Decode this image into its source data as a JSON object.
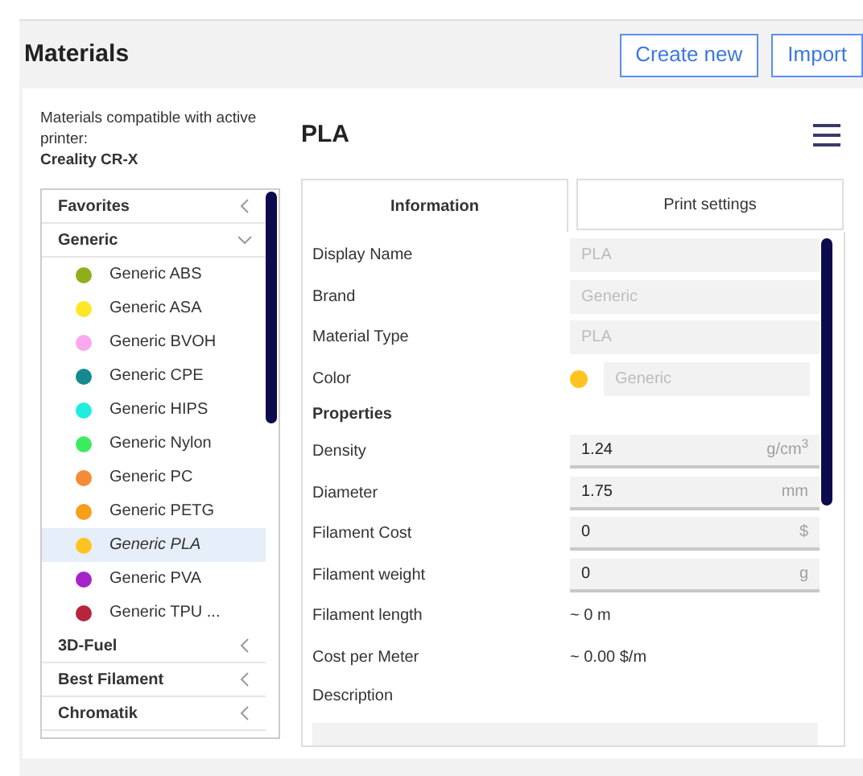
{
  "title": "Materials",
  "buttons": [
    "Create new",
    "Import"
  ],
  "compat": {
    "label": "Materials compatible with active printer:",
    "printer": "Creality CR-X"
  },
  "categories": [
    {
      "name": "Favorites",
      "expanded": false
    },
    {
      "name": "Generic",
      "expanded": true,
      "children": [
        {
          "name": "Generic ABS",
          "color": "#8fae1b",
          "selected": false
        },
        {
          "name": "Generic ASA",
          "color": "#fde725",
          "selected": false
        },
        {
          "name": "Generic BVOH",
          "color": "#fba8ee",
          "selected": false
        },
        {
          "name": "Generic CPE",
          "color": "#148a90",
          "selected": false
        },
        {
          "name": "Generic HIPS",
          "color": "#20ede0",
          "selected": false
        },
        {
          "name": "Generic Nylon",
          "color": "#3deb5f",
          "selected": false
        },
        {
          "name": "Generic PC",
          "color": "#f28c38",
          "selected": false
        },
        {
          "name": "Generic PETG",
          "color": "#f59f1b",
          "selected": false
        },
        {
          "name": "Generic PLA",
          "color": "#ffc41f",
          "selected": true
        },
        {
          "name": "Generic PVA",
          "color": "#a524c9",
          "selected": false
        },
        {
          "name": "Generic TPU ...",
          "color": "#b8233d",
          "selected": false
        }
      ]
    },
    {
      "name": "3D-Fuel",
      "expanded": false
    },
    {
      "name": "Best Filament",
      "expanded": false
    },
    {
      "name": "Chromatik",
      "expanded": false
    }
  ],
  "material_title": "PLA",
  "tabs": [
    {
      "label": "Information",
      "selected": true
    },
    {
      "label": "Print settings",
      "selected": false
    }
  ],
  "rows": [
    {
      "kind": "readonly",
      "label": "Display Name",
      "value": "PLA",
      "disabled": true
    },
    {
      "kind": "readonly",
      "label": "Brand",
      "value": "Generic",
      "disabled": true
    },
    {
      "kind": "readonly",
      "label": "Material Type",
      "value": "PLA",
      "disabled": true
    },
    {
      "kind": "color",
      "label": "Color",
      "value": "Generic",
      "color": "#ffc41f",
      "disabled": true
    },
    {
      "kind": "heading",
      "label": "Properties"
    },
    {
      "kind": "number",
      "label": "Density",
      "value": "1.24",
      "unit": "g/cm$^{3}$"
    },
    {
      "kind": "number",
      "label": "Diameter",
      "value": "1.75",
      "unit": "mm"
    },
    {
      "kind": "number",
      "label": "Filament Cost",
      "value": "0",
      "unit": "$"
    },
    {
      "kind": "number",
      "label": "Filament weight",
      "value": "0",
      "unit": "g"
    },
    {
      "kind": "info",
      "label": "Filament length",
      "value": "~ 0 m"
    },
    {
      "kind": "info",
      "label": "Cost per Meter",
      "value": "~ 0.00 $/m"
    },
    {
      "kind": "description",
      "label": "Description"
    }
  ]
}
